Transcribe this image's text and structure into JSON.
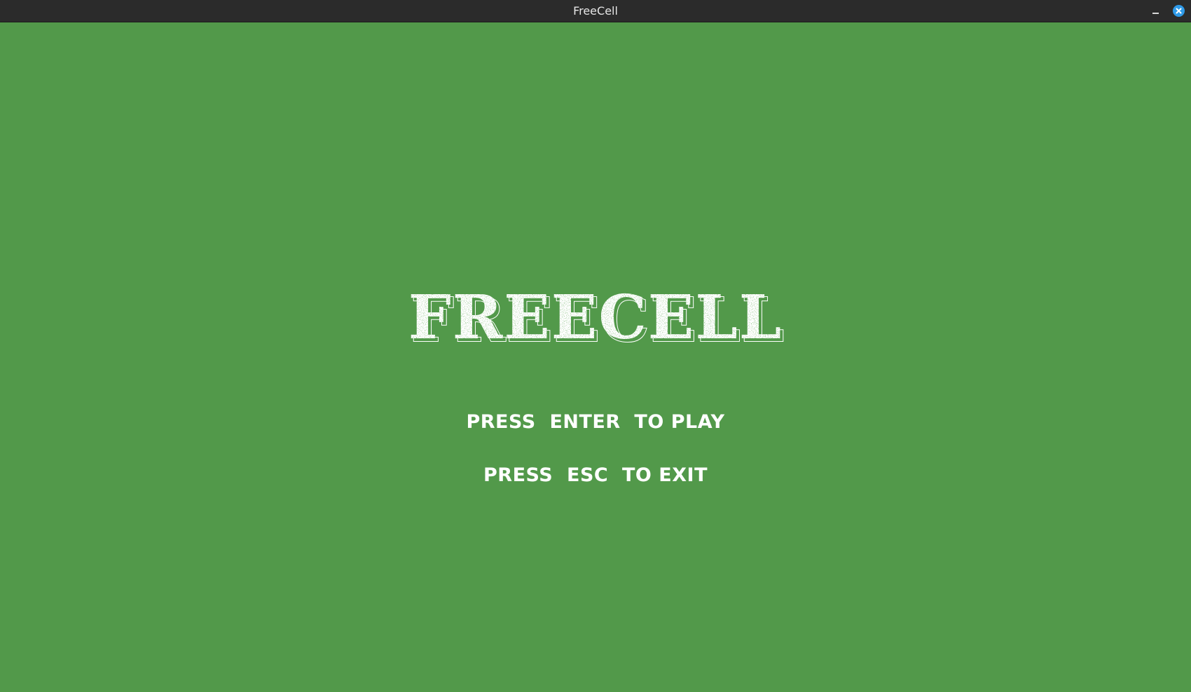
{
  "window": {
    "title": "FreeCell",
    "controls": {
      "minimize_icon": "minimize-icon",
      "close_icon": "close-icon",
      "close_color": "#2f9ae8"
    }
  },
  "game": {
    "background_color": "#52994a",
    "logo_text": "FREECELL",
    "prompts": {
      "play": "PRESS  ENTER  TO PLAY",
      "exit": "PRESS  ESC  TO EXIT"
    },
    "text_color": "#ffffff"
  }
}
